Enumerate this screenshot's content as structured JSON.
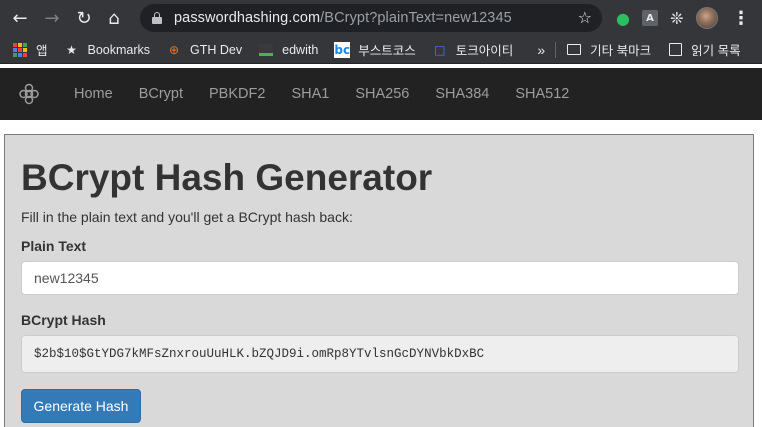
{
  "browser": {
    "url_host": "passwordhashing.com",
    "url_path": "/BCrypt?plainText=new12345"
  },
  "bookmarks": {
    "apps_label": "앱",
    "items": [
      {
        "label": "Bookmarks",
        "icon": "star-icon"
      },
      {
        "label": "GTH Dev",
        "icon": "gth-dev-icon"
      },
      {
        "label": "edwith",
        "icon": "edwith-icon"
      },
      {
        "label": "부스트코스",
        "icon": "boostcourse-icon",
        "icon_text": "bc"
      },
      {
        "label": "토크아이티",
        "icon": "talkit-icon"
      }
    ],
    "other_folder": "기타 북마크",
    "reading_list": "읽기 목록"
  },
  "site_nav": {
    "links": [
      "Home",
      "BCrypt",
      "PBKDF2",
      "SHA1",
      "SHA256",
      "SHA384",
      "SHA512"
    ]
  },
  "main": {
    "title": "BCrypt Hash Generator",
    "subtitle": "Fill in the plain text and you'll get a BCrypt hash back:",
    "plain_label": "Plain Text",
    "plain_value": "new12345",
    "hash_label": "BCrypt Hash",
    "hash_value": "$2b$10$GtYDG7kMFsZnxrouUuHLK.bZQJD9i.omRp8YTvlsnGcDYNVbkDxBC",
    "button_label": "Generate Hash"
  },
  "colors": {
    "navbar_bg": "#222222",
    "panel_bg": "#d9d9d9",
    "primary_button": "#337ab7"
  }
}
